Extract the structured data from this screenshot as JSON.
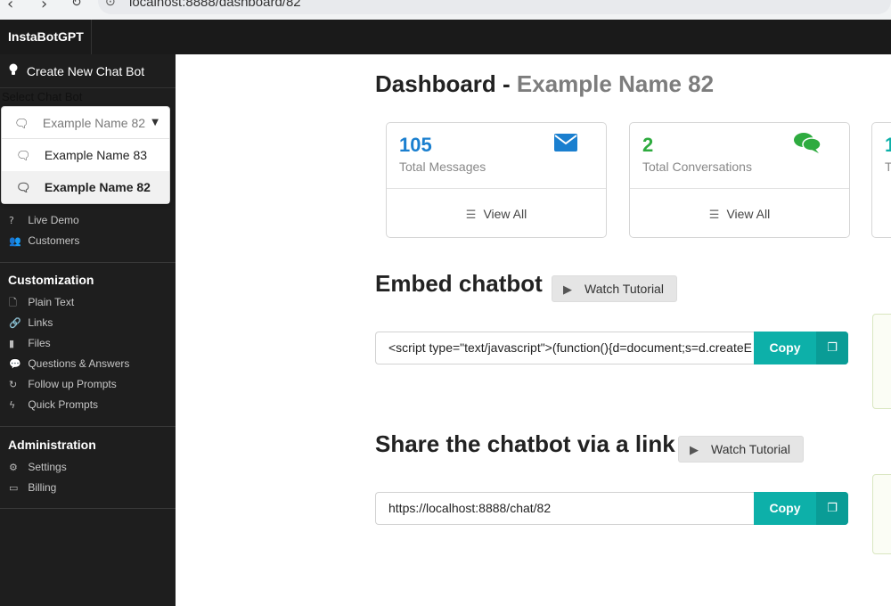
{
  "browser": {
    "url": "localhost:8888/dashboard/82"
  },
  "app": {
    "brand": "InstaBotGPT",
    "accent": "#0db0a9"
  },
  "sidebar": {
    "create_label": "Create New Chat Bot",
    "select_label": "Select Chat Bot",
    "dropdown": {
      "selected": "Example Name 82",
      "options": [
        "Example Name 83",
        "Example Name 82"
      ]
    },
    "items_top": [
      {
        "label": "Live Demo",
        "icon": "question-icon"
      },
      {
        "label": "Customers",
        "icon": "users-icon"
      }
    ],
    "customization": {
      "heading": "Customization",
      "items": [
        {
          "label": "Plain Text",
          "icon": "file-icon"
        },
        {
          "label": "Links",
          "icon": "link-icon"
        },
        {
          "label": "Files",
          "icon": "file-solid-icon"
        },
        {
          "label": "Questions & Answers",
          "icon": "comments-icon"
        },
        {
          "label": "Follow up Prompts",
          "icon": "redo-icon"
        },
        {
          "label": "Quick Prompts",
          "icon": "bolt-icon"
        }
      ]
    },
    "administration": {
      "heading": "Administration",
      "items": [
        {
          "label": "Settings",
          "icon": "gear-icon"
        },
        {
          "label": "Billing",
          "icon": "credit-card-icon"
        }
      ]
    }
  },
  "main": {
    "title": "Dashboard - ",
    "title_name": "Example Name 82",
    "stats": [
      {
        "value": "105",
        "label": "Total Messages",
        "link": "View All",
        "color": "#1a7fcf",
        "icon": "envelope-icon"
      },
      {
        "value": "2",
        "label": "Total Conversations",
        "link": "View All",
        "color": "#2eab3f",
        "icon": "comments-icon"
      },
      {
        "value": "1",
        "label": "T",
        "color": "#0db0a9"
      }
    ],
    "embed": {
      "title": "Embed chatbot",
      "tutorial": "Watch Tutorial",
      "code": "<script type=\"text/javascript\">(function(){d=document;s=d.createE",
      "copy": "Copy"
    },
    "share": {
      "title": "Share the chatbot via a link",
      "tutorial": "Watch Tutorial",
      "link": "https://localhost:8888/chat/82",
      "copy": "Copy"
    }
  }
}
